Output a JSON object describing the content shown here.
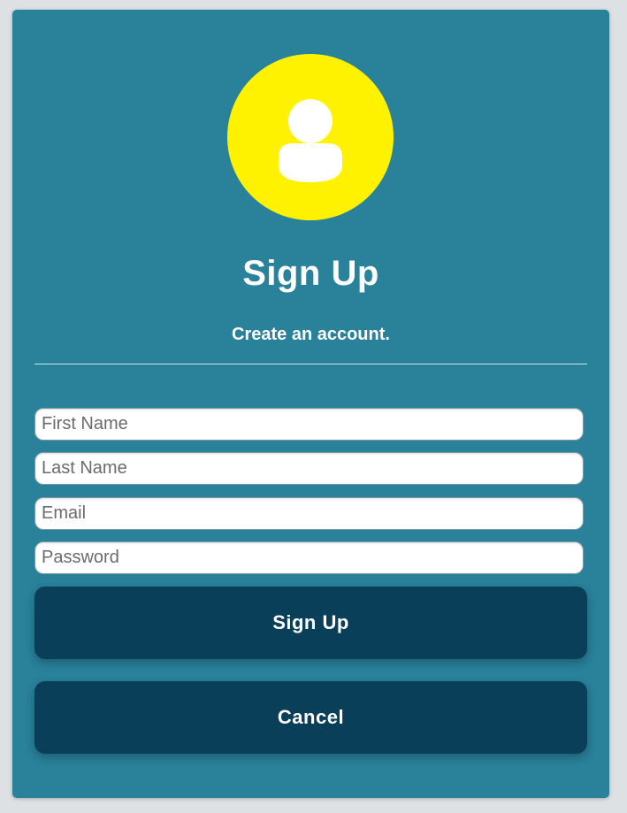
{
  "form": {
    "title": "Sign Up",
    "subtitle": "Create an account.",
    "fields": {
      "first_name": {
        "placeholder": "First Name",
        "value": ""
      },
      "last_name": {
        "placeholder": "Last Name",
        "value": ""
      },
      "email": {
        "placeholder": "Email",
        "value": ""
      },
      "password": {
        "placeholder": "Password",
        "value": ""
      }
    },
    "buttons": {
      "submit_label": "Sign Up",
      "cancel_label": "Cancel"
    }
  },
  "icons": {
    "avatar": "user-icon"
  },
  "colors": {
    "page_background": "#dde1e4",
    "card_background": "#29819a",
    "avatar_background": "#fff200",
    "button_background": "#0a3f59",
    "text": "#ffffff"
  }
}
